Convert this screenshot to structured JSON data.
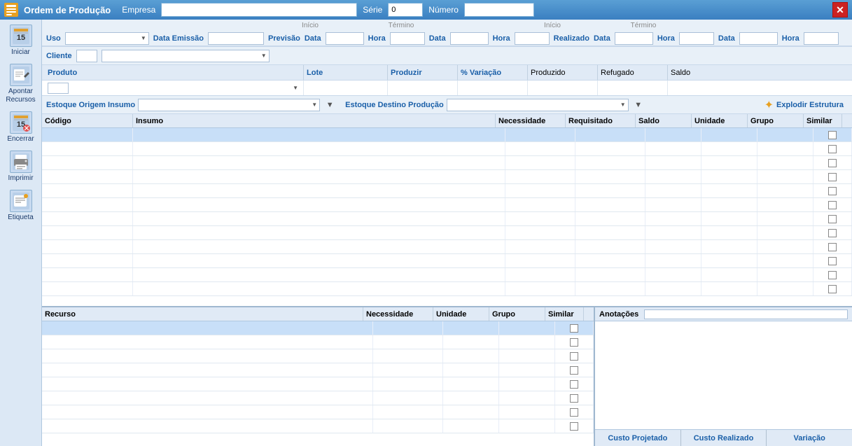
{
  "titlebar": {
    "icon": "OP",
    "title": "Ordem de Produção",
    "empresa_label": "Empresa",
    "serie_label": "Série",
    "serie_value": "0",
    "numero_label": "Número",
    "numero_value": "",
    "empresa_value": "",
    "close": "✕"
  },
  "form": {
    "uso_label": "Uso",
    "data_emissao_label": "Data Emissão",
    "cliente_label": "Cliente",
    "previsao_label": "Previsão",
    "realizado_label": "Realizado",
    "inicio_label": "Início",
    "termino_label": "Término",
    "data_label": "Data",
    "hora_label": "Hora"
  },
  "columns": {
    "produto_label": "Produto",
    "lote_label": "Lote",
    "produzir_label": "Produzir",
    "variacao_label": "% Variação",
    "produzido_label": "Produzido",
    "refugado_label": "Refugado",
    "saldo_label": "Saldo"
  },
  "estoque": {
    "origem_label": "Estoque Origem Insumo",
    "destino_label": "Estoque Destino Produção",
    "explodir_label": "Explodir Estrutura"
  },
  "insumo_table": {
    "headers": [
      "Código",
      "Insumo",
      "Necessidade",
      "Requisitado",
      "Saldo",
      "Unidade",
      "Grupo",
      "Similar"
    ],
    "rows": 12
  },
  "resource_table": {
    "headers": [
      "Recurso",
      "Necessidade",
      "Unidade",
      "Grupo",
      "Similar"
    ],
    "rows": 8
  },
  "notes": {
    "label": "Anotações"
  },
  "costs": {
    "projetado": "Custo Projetado",
    "realizado": "Custo Realizado",
    "variacao": "Variação"
  },
  "sidebar": [
    {
      "id": "iniciar",
      "icon": "📅",
      "label": "Iniciar"
    },
    {
      "id": "apontar",
      "icon": "✏️",
      "label": "Apontar\nRecursos"
    },
    {
      "id": "encerrar",
      "icon": "📅",
      "label": "Encerrar"
    },
    {
      "id": "imprimir",
      "icon": "🖨️",
      "label": "Imprimir"
    },
    {
      "id": "etiqueta",
      "icon": "🏷️",
      "label": "Etiqueta"
    }
  ]
}
